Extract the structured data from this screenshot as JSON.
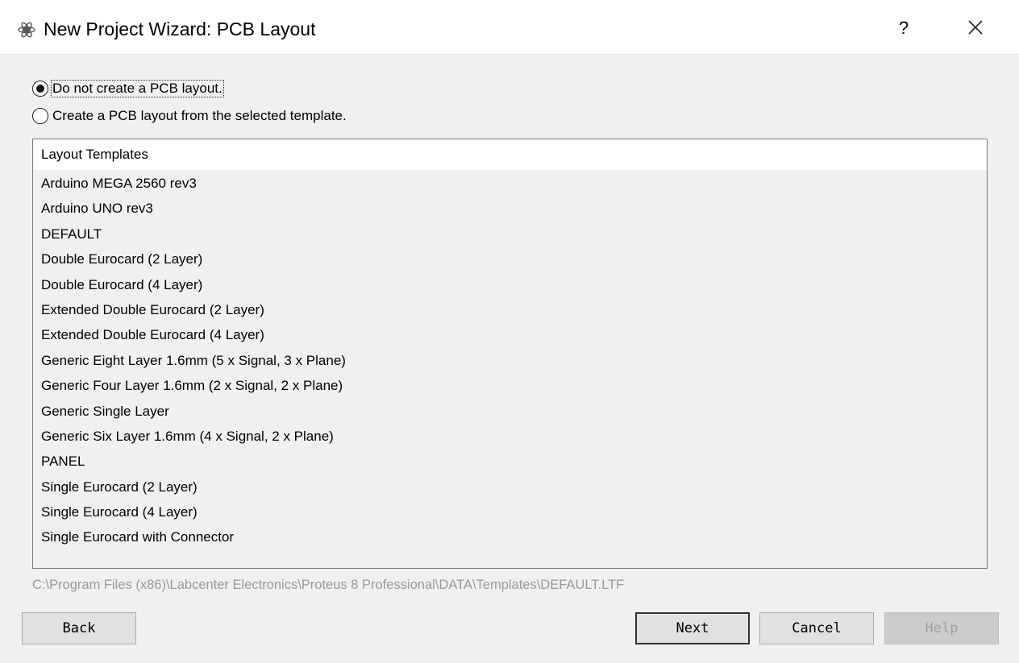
{
  "window": {
    "title": "New Project Wizard: PCB Layout",
    "help_label": "?",
    "app_icon": "proteus-icon",
    "close_icon": "close-icon"
  },
  "options": [
    {
      "label": "Do not create a PCB layout.",
      "checked": true
    },
    {
      "label": "Create a PCB layout from the selected template.",
      "checked": false
    }
  ],
  "templates": {
    "header": "Layout Templates",
    "items": [
      "Arduino MEGA 2560 rev3",
      "Arduino UNO rev3",
      "DEFAULT",
      "Double Eurocard (2 Layer)",
      "Double Eurocard (4 Layer)",
      "Extended Double Eurocard (2 Layer)",
      "Extended Double Eurocard (4 Layer)",
      "Generic Eight Layer 1.6mm (5 x Signal, 3 x Plane)",
      "Generic Four Layer 1.6mm (2 x Signal, 2 x Plane)",
      "Generic Single Layer",
      "Generic Six Layer 1.6mm (4 x Signal, 2 x Plane)",
      "PANEL",
      "Single Eurocard (2 Layer)",
      "Single Eurocard (4 Layer)",
      "Single Eurocard with Connector"
    ]
  },
  "template_path": "C:\\Program Files (x86)\\Labcenter Electronics\\Proteus 8 Professional\\DATA\\Templates\\DEFAULT.LTF",
  "buttons": {
    "back": "Back",
    "next": "Next",
    "cancel": "Cancel",
    "help": "Help"
  }
}
